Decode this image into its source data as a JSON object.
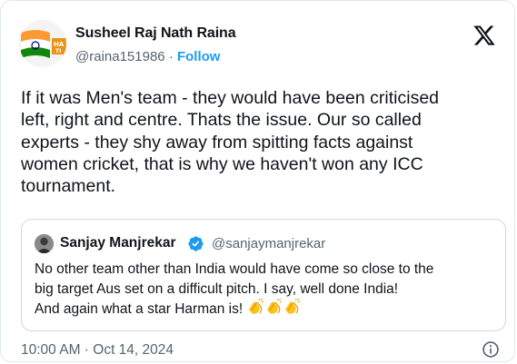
{
  "tweet": {
    "author": {
      "name": "Susheel Raj Nath Raina",
      "handle": "@raina151986",
      "separator": "·",
      "follow_label": "Follow"
    },
    "text_lines": [
      "If it was Men's team - they would have been criticised",
      "left, right and centre. Thats the issue. Our so called",
      "experts - they shy away from spitting facts against",
      "women cricket, that is why we haven't won any ICC",
      "tournament."
    ],
    "timestamp": "10:00 AM · Oct 14, 2024"
  },
  "quoted_tweet": {
    "author": {
      "name": "Sanjay Manjrekar",
      "handle": "@sanjaymanjrekar",
      "verified": true
    },
    "text_lines": [
      "No other team other than India would have come so close to the",
      "big target Aus set on a difficult pitch. I say, well done India!",
      "And again what a star Harman is!"
    ],
    "emojis": [
      "clapping-hands",
      "clapping-hands",
      "clapping-hands"
    ]
  },
  "icons": {
    "logo": "x-logo-icon",
    "info": "info-icon",
    "verified": "verified-badge-icon"
  },
  "colors": {
    "link": "#1d9bf0",
    "secondary_text": "#536471",
    "verified": "#1d9bf0",
    "border": "#cfd9de"
  }
}
